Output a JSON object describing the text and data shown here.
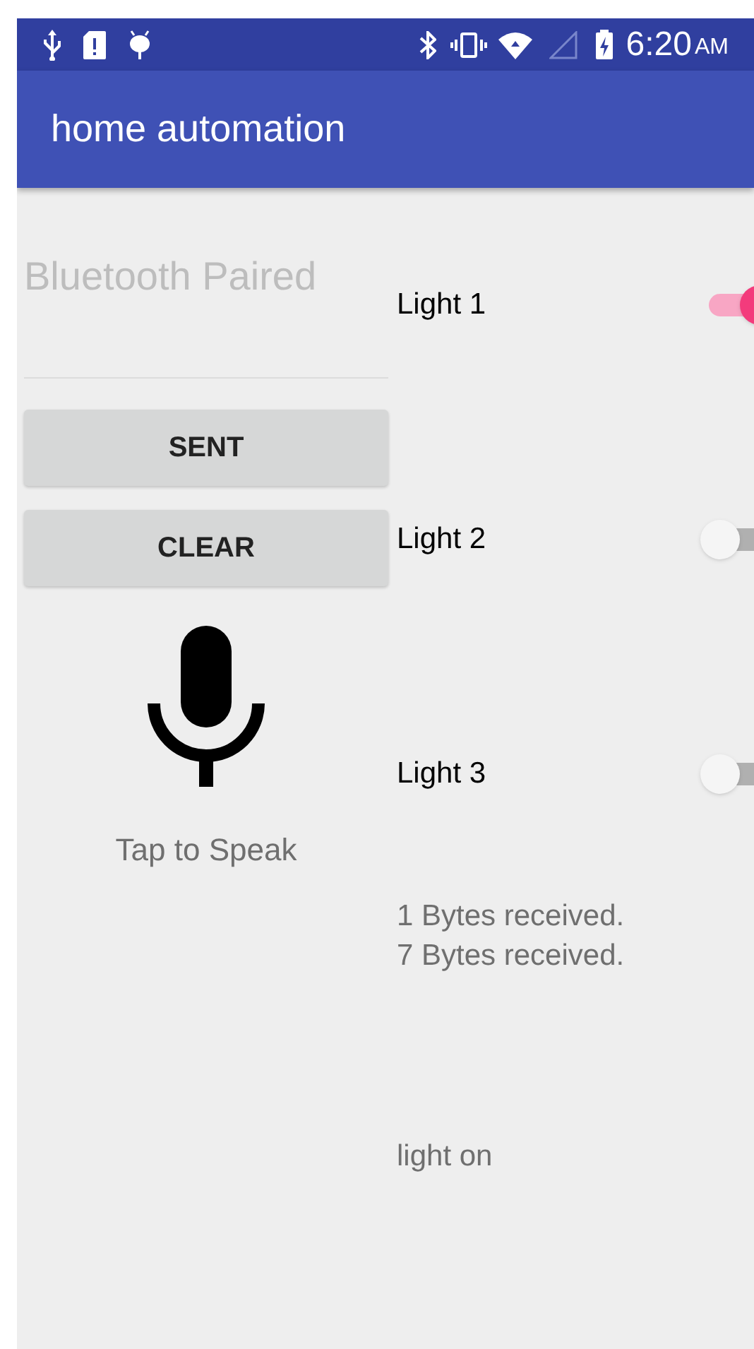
{
  "status_bar": {
    "time": "6:20",
    "meridiem": "AM"
  },
  "app_bar": {
    "title": "home automation"
  },
  "bluetooth_field": {
    "placeholder": "Bluetooth Paired"
  },
  "buttons": [
    "SENT",
    "CLEAR"
  ],
  "voice": {
    "label": "Tap to Speak"
  },
  "lights": [
    {
      "label": "Light 1",
      "on": true
    },
    {
      "label": "Light 2",
      "on": false
    },
    {
      "label": "Light 3",
      "on": false
    }
  ],
  "log": [
    "1 Bytes received.",
    "7 Bytes received."
  ],
  "result": "light on"
}
